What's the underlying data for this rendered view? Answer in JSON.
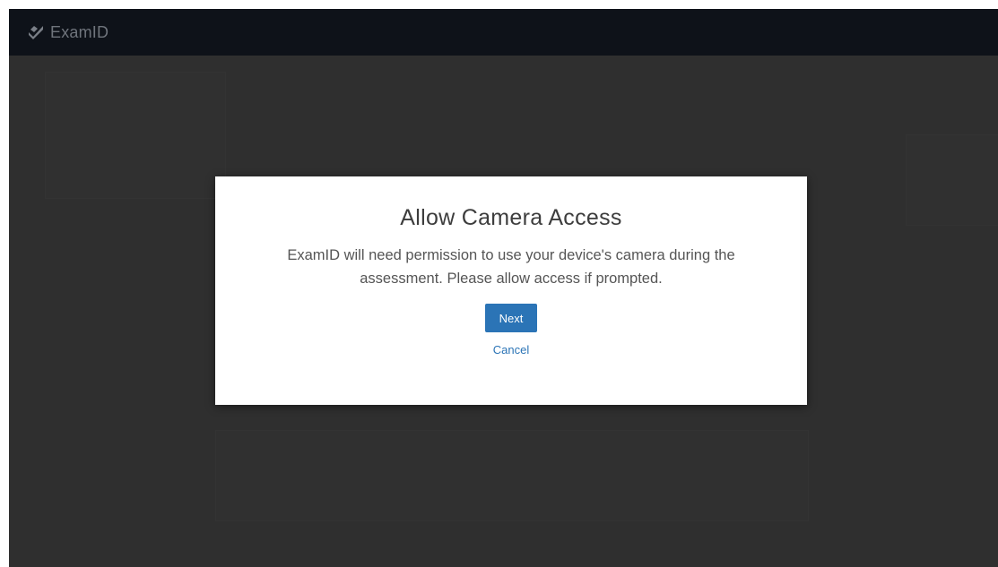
{
  "app": {
    "brand_name": "ExamID",
    "brand_icon": "check-shield-icon"
  },
  "modal": {
    "title": "Allow Camera Access",
    "body": "ExamID will need permission to use your device's camera during the assessment. Please allow access if prompted.",
    "next_label": "Next",
    "cancel_label": "Cancel"
  },
  "colors": {
    "accent": "#2b74b6",
    "topbar": "#0e1219",
    "backdrop": "#333333"
  }
}
